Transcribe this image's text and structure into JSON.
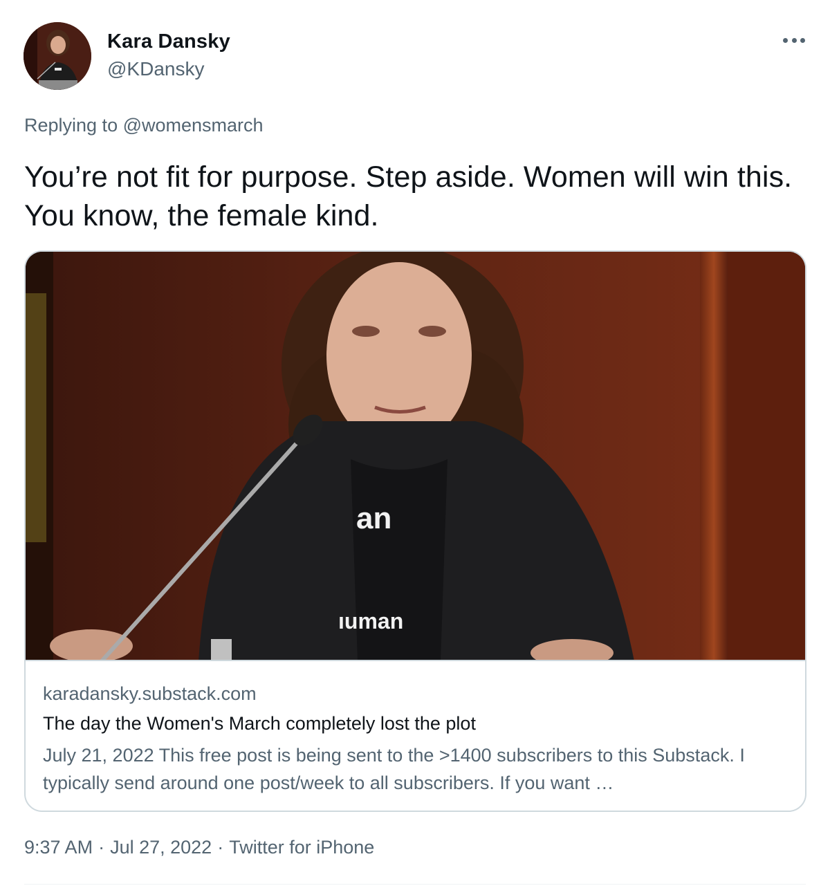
{
  "author": {
    "name": "Kara Dansky",
    "handle": "@KDansky"
  },
  "reply": {
    "prefix": "Replying to ",
    "mention": "@womensmarch"
  },
  "tweet_text": "You’re not fit for purpose. Step aside. Women will win this. You know, the female kind.",
  "card": {
    "shirt_text_top": "an",
    "shirt_text_bottom": "ıuman",
    "domain": "karadansky.substack.com",
    "title": "The day the Women's March completely lost the plot",
    "description": "July 21, 2022 This free post is being sent to the >1400 subscribers to this Substack. I typically send around one post/week to all subscribers. If you want …"
  },
  "meta": {
    "time": "9:37 AM",
    "date": "Jul 27, 2022",
    "source": "Twitter for iPhone",
    "separator": "·"
  },
  "colors": {
    "text_primary": "#0f1419",
    "text_secondary": "#536471",
    "border": "#cfd9de"
  }
}
